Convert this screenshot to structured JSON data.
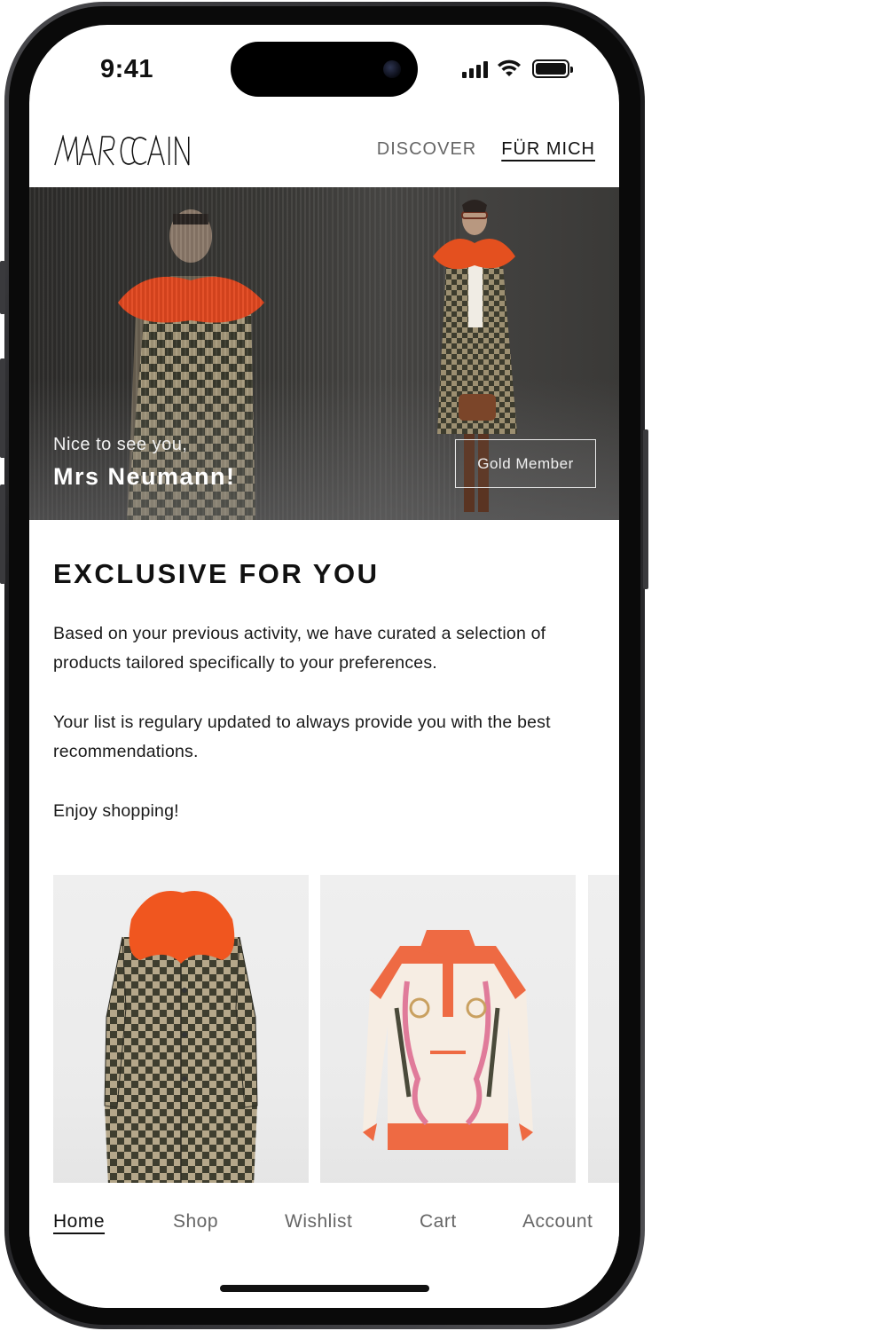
{
  "status_bar": {
    "time": "9:41"
  },
  "header": {
    "logo": "MARCCAIN",
    "nav": [
      {
        "label": "DISCOVER",
        "active": false
      },
      {
        "label": "FÜR MICH",
        "active": true
      }
    ]
  },
  "hero": {
    "greeting": "Nice to see you,",
    "name": "Mrs Neumann!",
    "membership_button": "Gold Member"
  },
  "section": {
    "title": "EXCLUSIVE FOR YOU",
    "paragraphs": [
      "Based on your previous activity, we have curated a selection of products tailored specifically to your preferences.",
      "Your list is regulary updated to always provide you with the best recommendations.",
      "Enjoy shopping!"
    ]
  },
  "products": [
    {
      "icon": "houndstooth-coat-with-orange-fur-collar"
    },
    {
      "icon": "printed-silk-blouse"
    },
    {
      "icon": "product-partial"
    }
  ],
  "bottom_nav": {
    "items": [
      {
        "label": "Home",
        "active": true
      },
      {
        "label": "Shop",
        "active": false
      },
      {
        "label": "Wishlist",
        "active": false
      },
      {
        "label": "Cart",
        "active": false
      },
      {
        "label": "Account",
        "active": false
      }
    ]
  },
  "colors": {
    "accent_orange": "#e8552a",
    "text_dark": "#111111",
    "text_muted": "#666666",
    "hero_bg": "#3b3a37"
  }
}
